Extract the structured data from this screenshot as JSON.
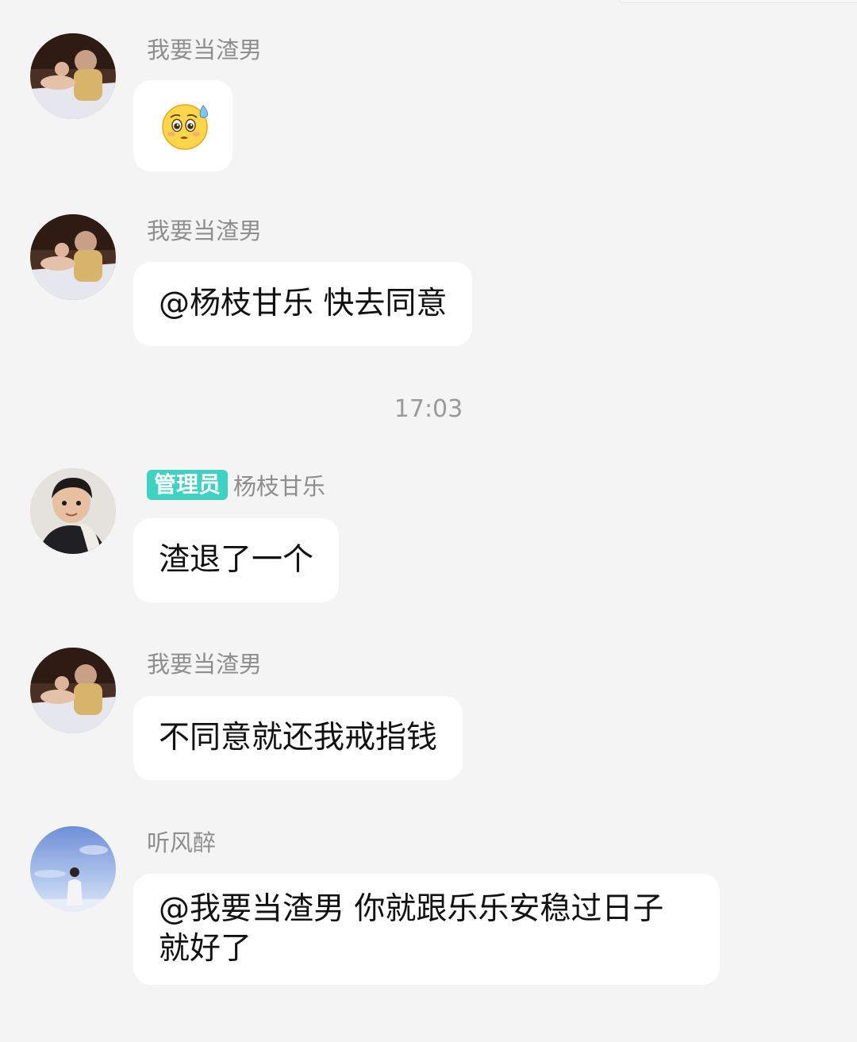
{
  "messages": [
    {
      "sender": "我要当渣男",
      "avatar": "tan-photo-avatar",
      "content_icon": "worried-sweat-emoji"
    },
    {
      "sender": "我要当渣男",
      "avatar": "tan-photo-avatar",
      "text": "@杨枝甘乐 快去同意"
    },
    {
      "sender": "杨枝甘乐",
      "badge": "管理员",
      "avatar": "boy-photo-avatar",
      "text": "渣退了一个"
    },
    {
      "sender": "我要当渣男",
      "avatar": "tan-photo-avatar",
      "text": "不同意就还我戒指钱"
    },
    {
      "sender": "听风醉",
      "avatar": "sky-photo-avatar",
      "text": "@我要当渣男 你就跟乐乐安稳过日子就好了"
    }
  ],
  "time_separator": "17:03",
  "colors": {
    "background": "#f4f4f4",
    "bubble": "#ffffff",
    "sender_name": "#8e8e8e",
    "admin_badge": "#3fd2c2",
    "message_text": "#111111"
  }
}
